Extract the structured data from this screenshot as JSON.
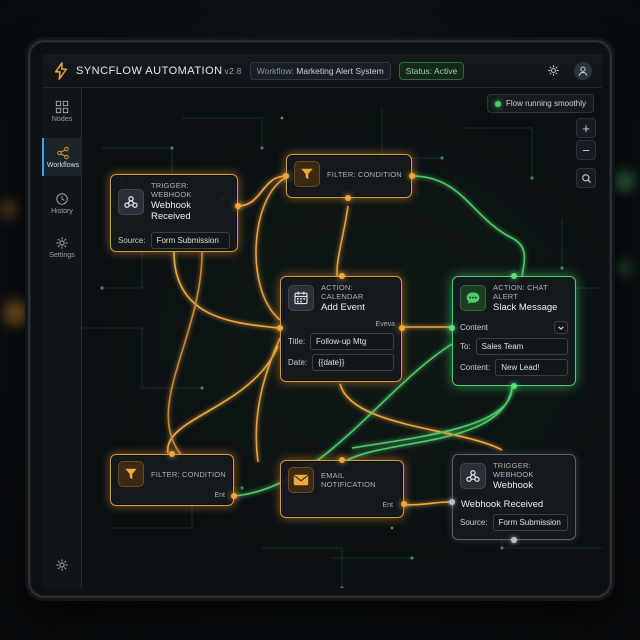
{
  "app": {
    "name": "SYNCFLOW AUTOMATION",
    "version": "v2.8"
  },
  "header": {
    "workflow_label": "Workflow:",
    "workflow_name": "Marketing Alert System",
    "status_label": "Status:",
    "status_value": "Active"
  },
  "sidebar": {
    "items": [
      {
        "label": "Nodes",
        "icon": "grid-icon"
      },
      {
        "label": "Workflows",
        "icon": "share-nodes-icon",
        "active": true
      },
      {
        "label": "History",
        "icon": "history-icon"
      },
      {
        "label": "Settings",
        "icon": "gear-icon"
      }
    ]
  },
  "canvas": {
    "flow_status": "Flow running smoothly",
    "zoom_in": "+",
    "zoom_out": "−"
  },
  "nodes": {
    "trigger1": {
      "kind": "TRIGGER: WEBHOOK",
      "title": "Webhook Received",
      "field_label": "Source:",
      "field_value": "Form Submission"
    },
    "filter1": {
      "kind": "FILTER: CONDITION"
    },
    "calendar": {
      "kind": "ACTION: CALENDAR",
      "title": "Add Event",
      "side_label": "Eveva",
      "title_label": "Title:",
      "title_value": "Follow-up Mtg",
      "date_label": "Date:",
      "date_value": "{{date}}"
    },
    "chat": {
      "kind": "ACTION: CHAT ALERT",
      "title": "Slack Message",
      "content_label": "Content",
      "to_label": "To:",
      "to_value": "Sales Team",
      "content2_label": "Content:",
      "content2_value": "New Lead!"
    },
    "filter2": {
      "kind": "FILTER: CONDITION",
      "side_label": "Ent"
    },
    "email": {
      "kind": "EMAIL NOTIFICATION",
      "side_label": "Ent"
    },
    "trigger2": {
      "kind": "TRIGGER: WEBHOOK",
      "title": "Webhook",
      "subtitle": "Webhook Received",
      "field_label": "Source:",
      "field_value": "Form Submission"
    }
  },
  "colors": {
    "accent_orange": "#f2a83e",
    "accent_green": "#4ccf6a",
    "bg": "#0b1012"
  }
}
